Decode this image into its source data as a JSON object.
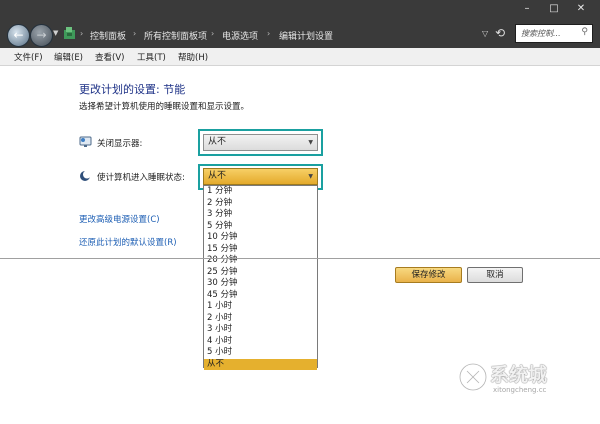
{
  "window": {
    "minimize": "–",
    "maximize": "□",
    "close": "✕"
  },
  "address_bar": {
    "breadcrumbs": [
      "控制面板",
      "所有控制面板项",
      "电源选项",
      "编辑计划设置"
    ],
    "separator": "›",
    "search_placeholder": "搜索控制..."
  },
  "menu": {
    "items": [
      "文件(F)",
      "编辑(E)",
      "查看(V)",
      "工具(T)",
      "帮助(H)"
    ]
  },
  "content": {
    "title": "更改计划的设置: 节能",
    "subtitle": "选择希望计算机使用的睡眠设置和显示设置。",
    "display_label": "关闭显示器:",
    "display_value": "从不",
    "sleep_label": "使计算机进入睡眠状态:",
    "sleep_value": "从不",
    "sleep_options": [
      "1 分钟",
      "2 分钟",
      "3 分钟",
      "5 分钟",
      "10 分钟",
      "15 分钟",
      "20 分钟",
      "25 分钟",
      "30 分钟",
      "45 分钟",
      "1 小时",
      "2 小时",
      "3 小时",
      "4 小时",
      "5 小时",
      "从不"
    ],
    "selected_option_index": 15,
    "advanced_link": "更改高级电源设置(C)",
    "restore_link": "还原此计划的默认设置(R)"
  },
  "buttons": {
    "save": "保存修改",
    "cancel": "取消"
  },
  "watermark": {
    "text": "系统城",
    "url": "xitongcheng.cc"
  },
  "colors": {
    "titlebar": "#3a3a3a",
    "highlight_box": "#1aa0a0",
    "selection": "#e5b02e",
    "link": "#1e5fb4",
    "title_text": "#1e3287"
  }
}
